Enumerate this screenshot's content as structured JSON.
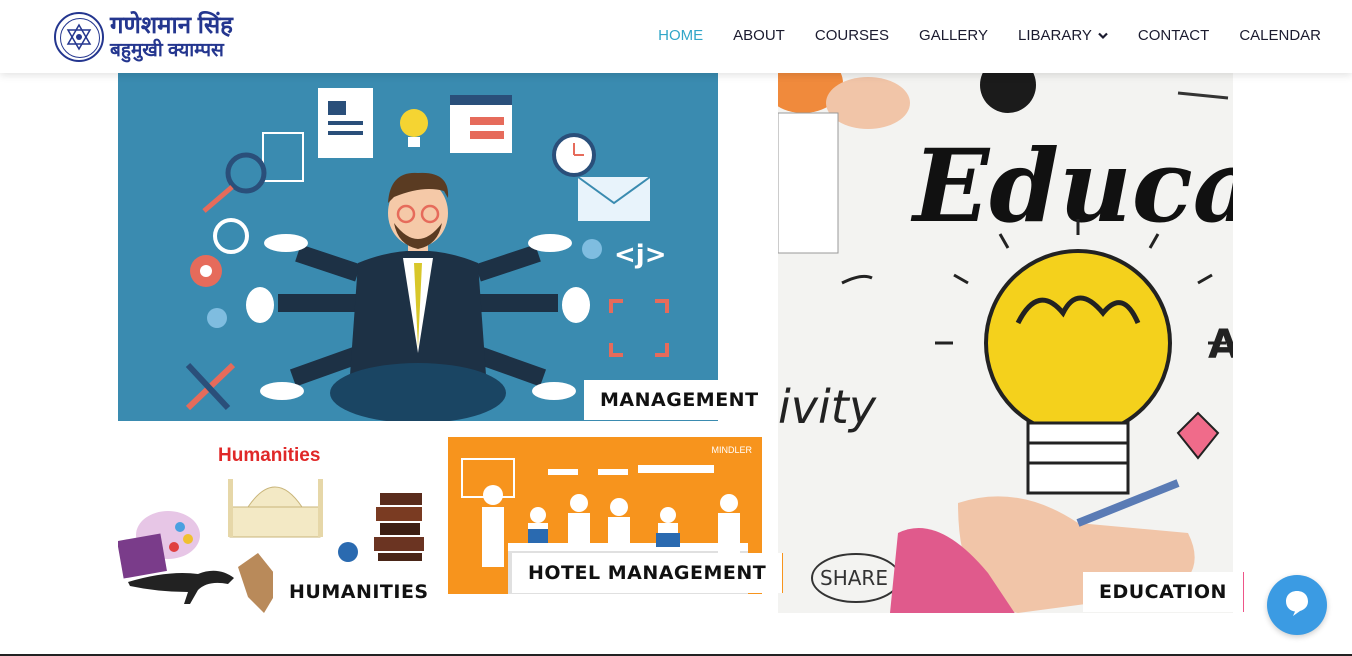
{
  "brand": {
    "line1": "गणेशमान सिंह",
    "line2": "बहुमुखी क्याम्पस"
  },
  "nav": {
    "items": [
      {
        "label": "HOME",
        "active": true
      },
      {
        "label": "ABOUT"
      },
      {
        "label": "COURSES"
      },
      {
        "label": "GALLERY"
      },
      {
        "label": "LIBARARY",
        "has_dropdown": true
      },
      {
        "label": "CONTACT"
      },
      {
        "label": "CALENDAR"
      }
    ]
  },
  "courses": {
    "management": {
      "label": "MANAGEMENT"
    },
    "education": {
      "label": "EDUCATION",
      "image_text": "Education"
    },
    "humanities": {
      "label": "HUMANITIES",
      "image_title": "Humanities"
    },
    "hotel": {
      "label": "HOTEL MANAGEMENT",
      "image_brand": "MINDLER"
    }
  },
  "colors": {
    "accent": "#31a6c8",
    "brand": "#24368f",
    "management_bg": "#3a8bb0",
    "hotel_bg": "#f7941d",
    "chat": "#3b9be3"
  },
  "icons": {
    "dropdown": "chevron-down-icon",
    "chat": "chat-bubble-icon"
  }
}
